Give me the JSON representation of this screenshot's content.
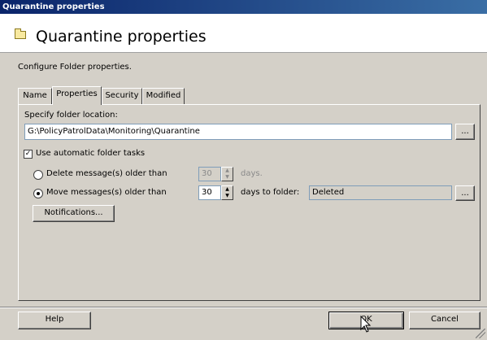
{
  "window": {
    "title": "Quarantine properties"
  },
  "header": {
    "title": "Quarantine properties",
    "icon": "folder-icon"
  },
  "description": "Configure Folder properties.",
  "tabs": [
    {
      "label": "Name",
      "active": false
    },
    {
      "label": "Properties",
      "active": true
    },
    {
      "label": "Security",
      "active": false
    },
    {
      "label": "Modified",
      "active": false
    }
  ],
  "properties": {
    "folder_location_label": "Specify folder location:",
    "folder_location_value": "G:\\PolicyPatrolData\\Monitoring\\Quarantine",
    "browse_label": "...",
    "auto_tasks": {
      "label": "Use automatic folder tasks",
      "checked": true
    },
    "delete_option": {
      "label": "Delete message(s) older than",
      "selected": false,
      "days": "30",
      "suffix": "days."
    },
    "move_option": {
      "label": "Move messages(s) older than",
      "selected": true,
      "days": "30",
      "suffix": "days to folder:",
      "folder": "Deleted"
    },
    "notifications_label": "Notifications..."
  },
  "footer": {
    "help_label": "Help",
    "ok_label": "OK",
    "cancel_label": "Cancel"
  }
}
